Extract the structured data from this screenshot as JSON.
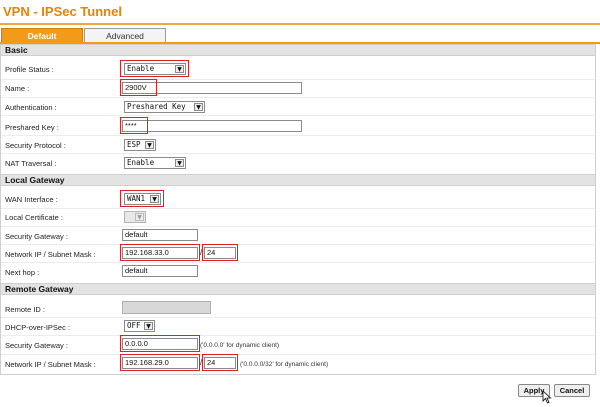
{
  "page_title": "VPN - IPSec Tunnel",
  "tabs": [
    {
      "label": "Default",
      "active": true
    },
    {
      "label": "Advanced",
      "active": false
    }
  ],
  "sections": {
    "basic": "Basic",
    "local_gateway": "Local Gateway",
    "remote_gateway": "Remote Gateway"
  },
  "basic": {
    "profile_status": {
      "label": "Profile Status :",
      "value": "Enable"
    },
    "name": {
      "label": "Name :",
      "value": "2900V"
    },
    "authentication": {
      "label": "Authentication :",
      "value": "Preshared Key"
    },
    "preshared_key": {
      "label": "Preshared Key :",
      "value": "****"
    },
    "security_protocol": {
      "label": "Security Protocol :",
      "value": "ESP"
    },
    "nat_traversal": {
      "label": "NAT Traversal :",
      "value": "Enable"
    }
  },
  "local_gateway": {
    "wan_interface": {
      "label": "WAN Interface :",
      "value": "WAN1"
    },
    "local_certificate": {
      "label": "Local Certificate :",
      "value": ""
    },
    "security_gateway": {
      "label": "Security Gateway :",
      "value": "default"
    },
    "network_ip": {
      "label": "Network IP / Subnet Mask :",
      "ip": "192.168.33.0",
      "mask": "24"
    },
    "next_hop": {
      "label": "Next hop :",
      "value": "default"
    }
  },
  "remote_gateway": {
    "remote_id": {
      "label": "Remote ID :",
      "value": ""
    },
    "dhcp_over_ipsec": {
      "label": "DHCP-over-IPSec :",
      "value": "OFF"
    },
    "security_gateway": {
      "label": "Security Gateway :",
      "value": "0.0.0.0",
      "hint": "('0.0.0.0' for dynamic client)"
    },
    "network_ip": {
      "label": "Network IP / Subnet Mask :",
      "ip": "192.168.29.0",
      "mask": "24",
      "hint": "('0.0.0.0/32' for dynamic client)"
    }
  },
  "slash": "/",
  "arrow_glyph": "▼",
  "buttons": {
    "apply": "Apply",
    "cancel": "Cancel"
  },
  "colors": {
    "accent": "#f39a1a",
    "title": "#e8820a",
    "highlight": "#e02020"
  }
}
